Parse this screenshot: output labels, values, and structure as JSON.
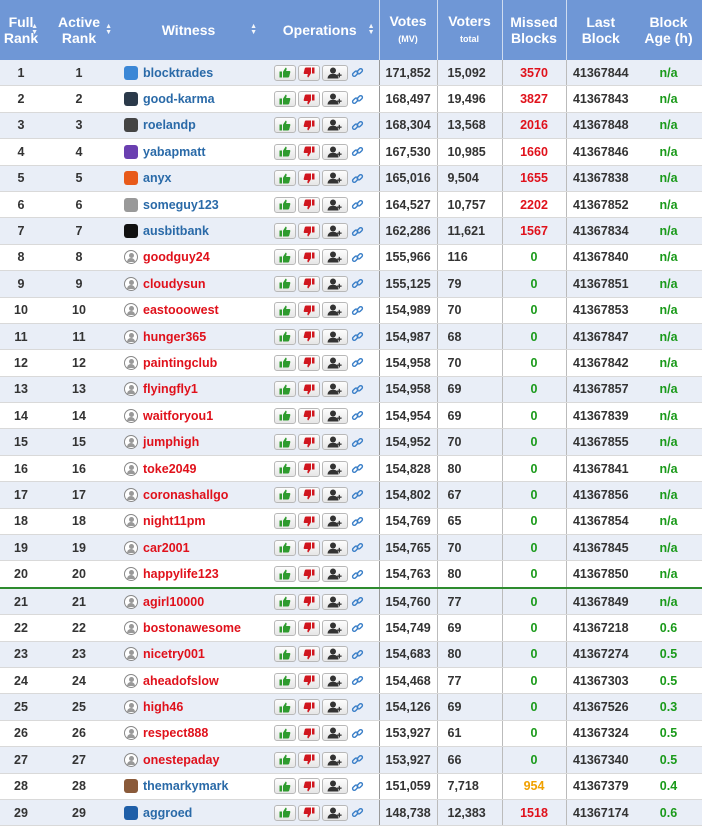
{
  "headers": {
    "full_rank": "Full Rank",
    "active_rank": "Active Rank",
    "witness": "Witness",
    "operations": "Operations",
    "votes": "Votes",
    "votes_sub": "(MV)",
    "voters": "Voters",
    "voters_sub": "total",
    "missed_blocks": "Missed Blocks",
    "last_block": "Last Block",
    "block_age": "Block Age (h)"
  },
  "colors": {
    "header_bg": "#6f97d6",
    "active_witness": "#2a6aa8",
    "disabled_witness": "#e0111b",
    "missed_red": "#e0111b",
    "missed_green": "#1a9a1a",
    "missed_orange": "#f0a000",
    "age_green": "#1a9a1a"
  },
  "icons": [
    "sort-icon",
    "thumbs-up-icon",
    "thumbs-down-icon",
    "add-user-icon",
    "link-icon",
    "avatar-icon"
  ],
  "rows": [
    {
      "full": "1",
      "active": "1",
      "witness": "blocktrades",
      "status": "active",
      "avatar": "#3b87d6",
      "votes": "171,852",
      "voters": "15,092",
      "missed": "3570",
      "missed_color": "red",
      "last": "41367844",
      "age": "n/a"
    },
    {
      "full": "2",
      "active": "2",
      "witness": "good-karma",
      "status": "active",
      "avatar": "#2b3a4a",
      "votes": "168,497",
      "voters": "19,496",
      "missed": "3827",
      "missed_color": "red",
      "last": "41367843",
      "age": "n/a"
    },
    {
      "full": "3",
      "active": "3",
      "witness": "roelandp",
      "status": "active",
      "avatar": "#444444",
      "votes": "168,304",
      "voters": "13,568",
      "missed": "2016",
      "missed_color": "red",
      "last": "41367848",
      "age": "n/a"
    },
    {
      "full": "4",
      "active": "4",
      "witness": "yabapmatt",
      "status": "active",
      "avatar": "#6a3fb0",
      "votes": "167,530",
      "voters": "10,985",
      "missed": "1660",
      "missed_color": "red",
      "last": "41367846",
      "age": "n/a"
    },
    {
      "full": "5",
      "active": "5",
      "witness": "anyx",
      "status": "active",
      "avatar": "#e85a1a",
      "votes": "165,016",
      "voters": "9,504",
      "missed": "1655",
      "missed_color": "red",
      "last": "41367838",
      "age": "n/a"
    },
    {
      "full": "6",
      "active": "6",
      "witness": "someguy123",
      "status": "active",
      "avatar": "#999999",
      "votes": "164,527",
      "voters": "10,757",
      "missed": "2202",
      "missed_color": "red",
      "last": "41367852",
      "age": "n/a"
    },
    {
      "full": "7",
      "active": "7",
      "witness": "ausbitbank",
      "status": "active",
      "avatar": "#111111",
      "votes": "162,286",
      "voters": "11,621",
      "missed": "1567",
      "missed_color": "red",
      "last": "41367834",
      "age": "n/a"
    },
    {
      "full": "8",
      "active": "8",
      "witness": "goodguy24",
      "status": "disabled",
      "avatar": "default",
      "votes": "155,966",
      "voters": "116",
      "missed": "0",
      "missed_color": "green",
      "last": "41367840",
      "age": "n/a"
    },
    {
      "full": "9",
      "active": "9",
      "witness": "cloudysun",
      "status": "disabled",
      "avatar": "default",
      "votes": "155,125",
      "voters": "79",
      "missed": "0",
      "missed_color": "green",
      "last": "41367851",
      "age": "n/a"
    },
    {
      "full": "10",
      "active": "10",
      "witness": "eastooowest",
      "status": "disabled",
      "avatar": "default",
      "votes": "154,989",
      "voters": "70",
      "missed": "0",
      "missed_color": "green",
      "last": "41367853",
      "age": "n/a"
    },
    {
      "full": "11",
      "active": "11",
      "witness": "hunger365",
      "status": "disabled",
      "avatar": "default",
      "votes": "154,987",
      "voters": "68",
      "missed": "0",
      "missed_color": "green",
      "last": "41367847",
      "age": "n/a"
    },
    {
      "full": "12",
      "active": "12",
      "witness": "paintingclub",
      "status": "disabled",
      "avatar": "default",
      "votes": "154,958",
      "voters": "70",
      "missed": "0",
      "missed_color": "green",
      "last": "41367842",
      "age": "n/a"
    },
    {
      "full": "13",
      "active": "13",
      "witness": "flyingfly1",
      "status": "disabled",
      "avatar": "default",
      "votes": "154,958",
      "voters": "69",
      "missed": "0",
      "missed_color": "green",
      "last": "41367857",
      "age": "n/a"
    },
    {
      "full": "14",
      "active": "14",
      "witness": "waitforyou1",
      "status": "disabled",
      "avatar": "default",
      "votes": "154,954",
      "voters": "69",
      "missed": "0",
      "missed_color": "green",
      "last": "41367839",
      "age": "n/a"
    },
    {
      "full": "15",
      "active": "15",
      "witness": "jumphigh",
      "status": "disabled",
      "avatar": "default",
      "votes": "154,952",
      "voters": "70",
      "missed": "0",
      "missed_color": "green",
      "last": "41367855",
      "age": "n/a"
    },
    {
      "full": "16",
      "active": "16",
      "witness": "toke2049",
      "status": "disabled",
      "avatar": "default",
      "votes": "154,828",
      "voters": "80",
      "missed": "0",
      "missed_color": "green",
      "last": "41367841",
      "age": "n/a"
    },
    {
      "full": "17",
      "active": "17",
      "witness": "coronashallgo",
      "status": "disabled",
      "avatar": "default",
      "votes": "154,802",
      "voters": "67",
      "missed": "0",
      "missed_color": "green",
      "last": "41367856",
      "age": "n/a"
    },
    {
      "full": "18",
      "active": "18",
      "witness": "night11pm",
      "status": "disabled",
      "avatar": "default",
      "votes": "154,769",
      "voters": "65",
      "missed": "0",
      "missed_color": "green",
      "last": "41367854",
      "age": "n/a"
    },
    {
      "full": "19",
      "active": "19",
      "witness": "car2001",
      "status": "disabled",
      "avatar": "default",
      "votes": "154,765",
      "voters": "70",
      "missed": "0",
      "missed_color": "green",
      "last": "41367845",
      "age": "n/a"
    },
    {
      "full": "20",
      "active": "20",
      "witness": "happylife123",
      "status": "disabled",
      "avatar": "default",
      "votes": "154,763",
      "voters": "80",
      "missed": "0",
      "missed_color": "green",
      "last": "41367850",
      "age": "n/a"
    },
    {
      "full": "21",
      "active": "21",
      "witness": "agirl10000",
      "status": "disabled",
      "avatar": "default",
      "votes": "154,760",
      "voters": "77",
      "missed": "0",
      "missed_color": "green",
      "last": "41367849",
      "age": "n/a"
    },
    {
      "full": "22",
      "active": "22",
      "witness": "bostonawesome",
      "status": "disabled",
      "avatar": "default",
      "votes": "154,749",
      "voters": "69",
      "missed": "0",
      "missed_color": "green",
      "last": "41367218",
      "age": "0.6"
    },
    {
      "full": "23",
      "active": "23",
      "witness": "nicetry001",
      "status": "disabled",
      "avatar": "default",
      "votes": "154,683",
      "voters": "80",
      "missed": "0",
      "missed_color": "green",
      "last": "41367274",
      "age": "0.5"
    },
    {
      "full": "24",
      "active": "24",
      "witness": "aheadofslow",
      "status": "disabled",
      "avatar": "default",
      "votes": "154,468",
      "voters": "77",
      "missed": "0",
      "missed_color": "green",
      "last": "41367303",
      "age": "0.5"
    },
    {
      "full": "25",
      "active": "25",
      "witness": "high46",
      "status": "disabled",
      "avatar": "default",
      "votes": "154,126",
      "voters": "69",
      "missed": "0",
      "missed_color": "green",
      "last": "41367526",
      "age": "0.3"
    },
    {
      "full": "26",
      "active": "26",
      "witness": "respect888",
      "status": "disabled",
      "avatar": "default",
      "votes": "153,927",
      "voters": "61",
      "missed": "0",
      "missed_color": "green",
      "last": "41367324",
      "age": "0.5"
    },
    {
      "full": "27",
      "active": "27",
      "witness": "onestepaday",
      "status": "disabled",
      "avatar": "default",
      "votes": "153,927",
      "voters": "66",
      "missed": "0",
      "missed_color": "green",
      "last": "41367340",
      "age": "0.5"
    },
    {
      "full": "28",
      "active": "28",
      "witness": "themarkymark",
      "status": "active",
      "avatar": "#8a5a3a",
      "votes": "151,059",
      "voters": "7,718",
      "missed": "954",
      "missed_color": "orange",
      "last": "41367379",
      "age": "0.4"
    },
    {
      "full": "29",
      "active": "29",
      "witness": "aggroed",
      "status": "active",
      "avatar": "#1f5fa8",
      "votes": "148,738",
      "voters": "12,383",
      "missed": "1518",
      "missed_color": "red",
      "last": "41367174",
      "age": "0.6"
    }
  ]
}
